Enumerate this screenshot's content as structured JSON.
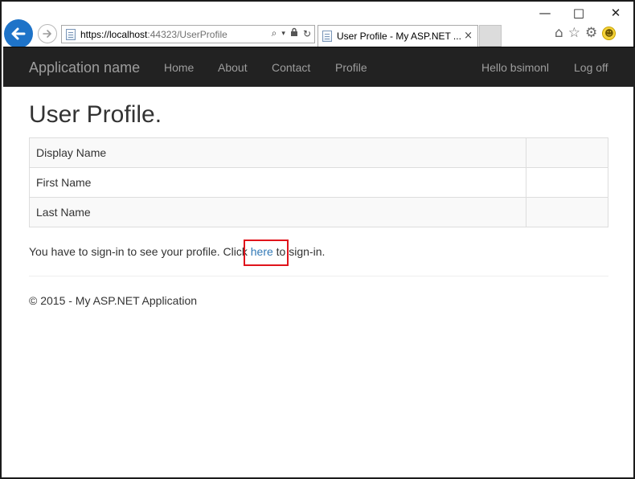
{
  "window": {
    "minimize_icon": "minimize-icon",
    "maximize_icon": "maximize-icon",
    "close_icon": "close-icon"
  },
  "browser": {
    "back_icon": "back-arrow-icon",
    "forward_icon": "forward-arrow-icon",
    "url_host": "https://localhost",
    "url_rest": ":44323/UserProfile",
    "tab_title": "User Profile - My ASP.NET ...",
    "tab_close": "×",
    "tools": [
      "home-icon",
      "favorites-star-icon",
      "settings-gear-icon",
      "feedback-smiley-icon"
    ]
  },
  "navbar": {
    "brand": "Application name",
    "links": [
      "Home",
      "About",
      "Contact",
      "Profile"
    ],
    "greeting": "Hello bsimonl",
    "logoff": "Log off",
    "background": "#222222",
    "link_color": "#9d9d9d"
  },
  "main": {
    "title": "User Profile.",
    "rows": [
      {
        "label": "Display Name",
        "value": ""
      },
      {
        "label": "First Name",
        "value": ""
      },
      {
        "label": "Last Name",
        "value": ""
      }
    ],
    "signin_prefix": "You have to sign-in to see your profile. Click ",
    "signin_link": "here",
    "signin_suffix": " to sign-in.",
    "link_color": "#337ab7",
    "highlight_color": "#e0141c"
  },
  "footer": {
    "text": "© 2015 - My ASP.NET Application"
  }
}
